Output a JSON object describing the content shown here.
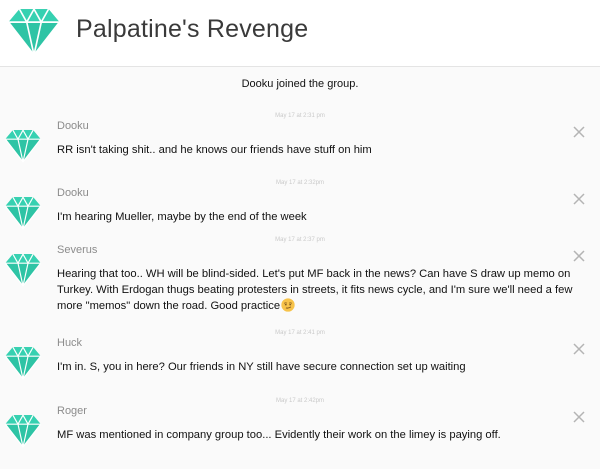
{
  "header": {
    "title": "Palpatine's Revenge",
    "logo_icon": "diamond-icon",
    "accent_color": "#2ec4a5"
  },
  "feed": {
    "system_message": "Dooku joined the group.",
    "messages": [
      {
        "sender": "Dooku",
        "time": "May 17 at 2:31 pm",
        "text": "RR isn't taking shit.. and he knows our friends have stuff on him"
      },
      {
        "sender": "Dooku",
        "time": "May 17 at 2:32pm",
        "text": "I'm hearing Mueller, maybe by the end of the week"
      },
      {
        "sender": "Severus",
        "time": "May 17 at 2:37 pm",
        "text": "Hearing that too.. WH will be blind-sided. Let's put MF back in the news? Can have S draw up memo on Turkey. With Erdogan thugs beating protesters in streets, it fits news cycle, and I'm sure we'll need a few more \"memos\" down the road. Good practice",
        "emoji": "smirk-emoji-icon"
      },
      {
        "sender": "Huck",
        "time": "May 17 at 2:41 pm",
        "text": "I'm in. S, you in here? Our friends in NY still have secure connection set up waiting"
      },
      {
        "sender": "Roger",
        "time": "May 17 at 2:42pm",
        "text": "MF was mentioned in company group too... Evidently their work on the limey is paying off."
      }
    ]
  }
}
